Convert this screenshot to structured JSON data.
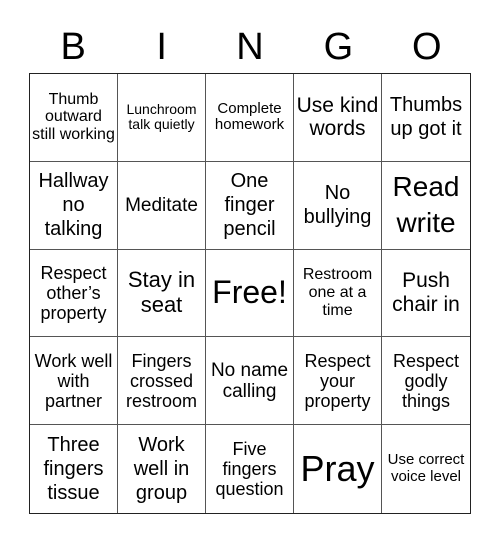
{
  "header": {
    "letters": [
      "B",
      "I",
      "N",
      "G",
      "O"
    ]
  },
  "cells": [
    "Thumb outward still working",
    "Lunchroom talk quietly",
    "Complete homework",
    "Use kind words",
    "Thumbs up got it",
    "Hallway no talking",
    "Meditate",
    "One finger pencil",
    "No bullying",
    "Read write",
    "Respect other’s property",
    "Stay in seat",
    "Free!",
    "Restroom one at a time",
    "Push chair in",
    "Work well with partner",
    "Fingers crossed restroom",
    "No name calling",
    "Respect your property",
    "Respect godly things",
    "Three fingers tissue",
    "Work well in group",
    "Five fingers question",
    "Pray",
    "Use correct voice level"
  ]
}
